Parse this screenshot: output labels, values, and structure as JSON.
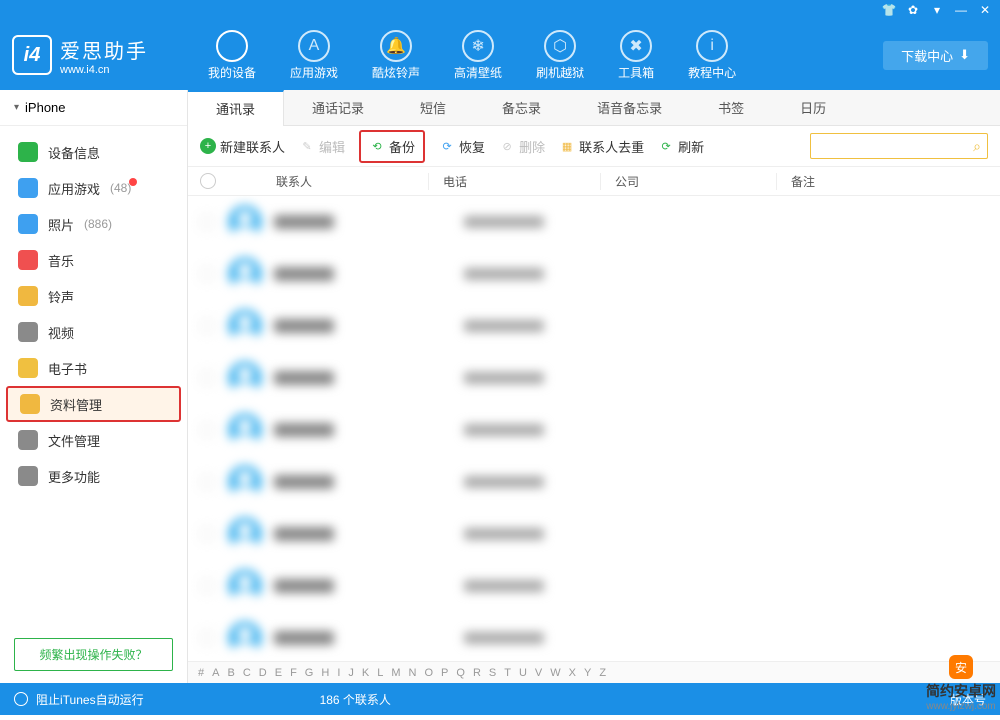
{
  "app": {
    "name": "爱思助手",
    "url": "www.i4.cn"
  },
  "titlebar": {
    "download": "下载中心"
  },
  "nav": [
    {
      "label": "我的设备",
      "icon": ""
    },
    {
      "label": "应用游戏",
      "icon": "A"
    },
    {
      "label": "酷炫铃声",
      "icon": "🔔"
    },
    {
      "label": "高清壁纸",
      "icon": "❄"
    },
    {
      "label": "刷机越狱",
      "icon": "⬡"
    },
    {
      "label": "工具箱",
      "icon": "✖"
    },
    {
      "label": "教程中心",
      "icon": "i"
    }
  ],
  "device": {
    "name": "iPhone"
  },
  "sidebar": [
    {
      "label": "设备信息",
      "color": "#2db34a"
    },
    {
      "label": "应用游戏",
      "count": "(48)",
      "color": "#3ea0f0",
      "dot": true
    },
    {
      "label": "照片",
      "count": "(886)",
      "color": "#3ea0f0"
    },
    {
      "label": "音乐",
      "color": "#f05050"
    },
    {
      "label": "铃声",
      "color": "#f0b840"
    },
    {
      "label": "视频",
      "color": "#8a8a8a"
    },
    {
      "label": "电子书",
      "color": "#f0c040"
    },
    {
      "label": "资料管理",
      "color": "#f0b840",
      "selected": true
    },
    {
      "label": "文件管理",
      "color": "#8a8a8a"
    },
    {
      "label": "更多功能",
      "color": "#8a8a8a"
    }
  ],
  "fail_link": "频繁出现操作失败？",
  "tabs": [
    "通讯录",
    "通话记录",
    "短信",
    "备忘录",
    "语音备忘录",
    "书签",
    "日历"
  ],
  "toolbar": {
    "new": "新建联系人",
    "edit": "编辑",
    "backup": "备份",
    "restore": "恢复",
    "delete": "删除",
    "dedup": "联系人去重",
    "refresh": "刷新"
  },
  "columns": {
    "contact": "联系人",
    "phone": "电话",
    "company": "公司",
    "note": "备注"
  },
  "alpha": [
    "#",
    "A",
    "B",
    "C",
    "D",
    "E",
    "F",
    "G",
    "H",
    "I",
    "J",
    "K",
    "L",
    "M",
    "N",
    "O",
    "P",
    "Q",
    "R",
    "S",
    "T",
    "U",
    "V",
    "W",
    "X",
    "Y",
    "Z"
  ],
  "status": {
    "itunes": "阻止iTunes自动运行",
    "count": "186 个联系人",
    "version": "版本号"
  },
  "watermark": {
    "text": "简约安卓网",
    "url": "www.jylzwj.com"
  }
}
